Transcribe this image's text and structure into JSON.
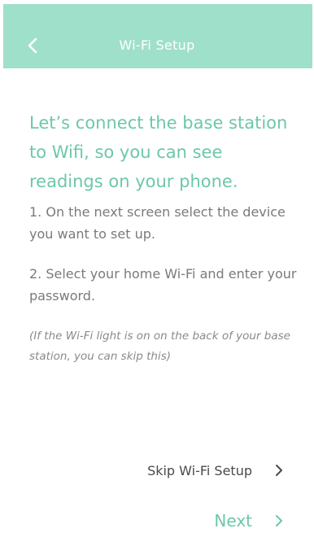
{
  "colors": {
    "accent": "#6cc8a8",
    "header_bg": "#9fe0cb",
    "body_text": "#7a7a7a",
    "dark_text": "#4a4a4a"
  },
  "header": {
    "title": "Wi-Fi Setup",
    "back_icon": "chevron-left-icon"
  },
  "content": {
    "headline": "Let’s connect the base station to Wifi, so you can see readings on your phone.",
    "step1": "1. On the next screen select the device you want to set up.",
    "step2": "2. Select your home Wi-Fi and enter your password.",
    "note": "(If the Wi-Fi light is on on the back of your base station, you can skip this)"
  },
  "actions": {
    "skip_label": "Skip Wi-Fi Setup",
    "skip_icon": "chevron-right-icon",
    "next_label": "Next",
    "next_icon": "chevron-right-icon"
  }
}
